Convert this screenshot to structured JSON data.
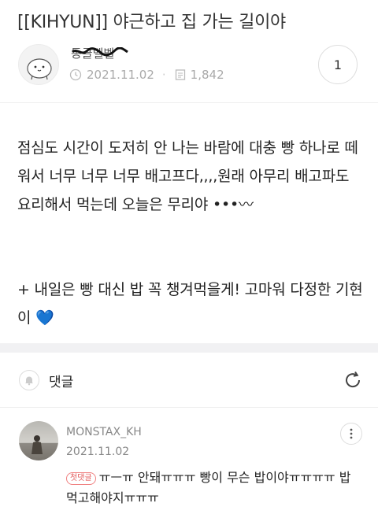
{
  "post": {
    "title": "[[KIHYUN]] 야근하고 집 가는 길이야",
    "author": "동글벨벨",
    "date": "2021.11.02",
    "views": "1,842",
    "comment_count": "1",
    "body": [
      "점심도 시간이 도저히 안 나는 바람에 대충 빵 하나로 떼워서 너무 너무 너무 배고프다,,,,원래 아무리 배고파도 요리해서 먹는데 오늘은 무리야 •••〰",
      "+ 내일은 빵 대신 밥 꼭 챙겨먹을게! 고마워 다정한 기현이 💙"
    ]
  },
  "comments_section": {
    "label": "댓글"
  },
  "comments": [
    {
      "author": "MONSTAX_KH",
      "date": "2021.11.02",
      "badge": "첫댓글",
      "text": "ㅠㅡㅠ 안돼ㅠㅠㅠ 빵이 무슨 밥이야ㅠㅠㅠㅠ 밥먹고해야지ㅠㅠㅠ"
    }
  ],
  "icons": {
    "clock": "clock-icon",
    "views": "document-icon",
    "bell": "bell-icon",
    "refresh": "refresh-icon",
    "more": "more-vertical-icon"
  }
}
